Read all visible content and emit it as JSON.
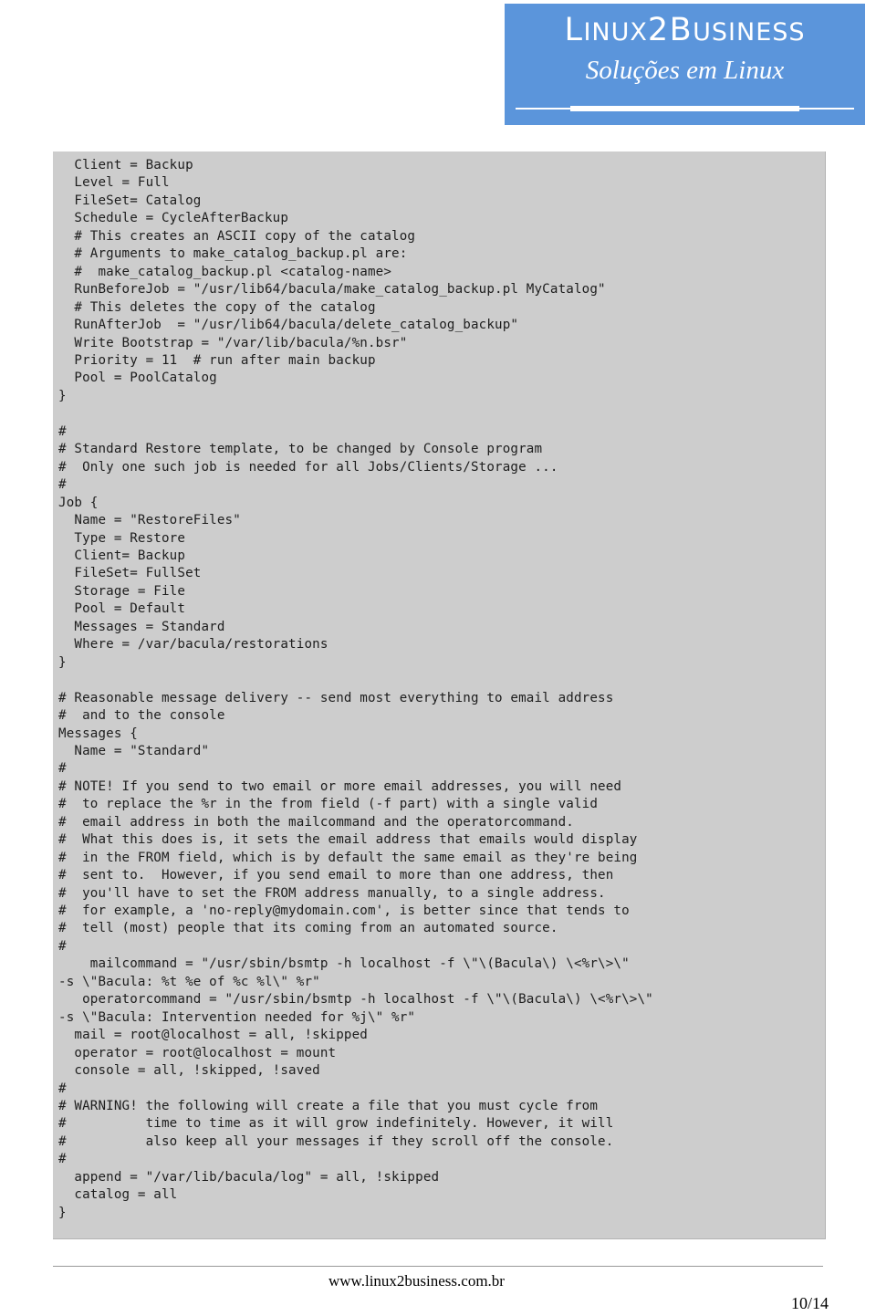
{
  "header": {
    "logo": {
      "wordmark_prefix": "L",
      "wordmark_small_1": "INUX",
      "wordmark_big": "2B",
      "wordmark_small_2": "USINESS",
      "wordmark_full": "LINUX2BUSINESS",
      "tagline": "Soluções em Linux",
      "background_color": "#5b95db",
      "text_color": "#ffffff"
    }
  },
  "code_block": {
    "background_color": "#cdcdcd",
    "text_color": "#1d1d1d",
    "language": "bacula-config",
    "content": "  Client = Backup\n  Level = Full\n  FileSet= Catalog\n  Schedule = CycleAfterBackup\n  # This creates an ASCII copy of the catalog\n  # Arguments to make_catalog_backup.pl are:\n  #  make_catalog_backup.pl <catalog-name>\n  RunBeforeJob = \"/usr/lib64/bacula/make_catalog_backup.pl MyCatalog\"\n  # This deletes the copy of the catalog\n  RunAfterJob  = \"/usr/lib64/bacula/delete_catalog_backup\"\n  Write Bootstrap = \"/var/lib/bacula/%n.bsr\"\n  Priority = 11  # run after main backup\n  Pool = PoolCatalog\n}\n\n#\n# Standard Restore template, to be changed by Console program\n#  Only one such job is needed for all Jobs/Clients/Storage ...\n#\nJob {\n  Name = \"RestoreFiles\"\n  Type = Restore\n  Client= Backup\n  FileSet= FullSet\n  Storage = File\n  Pool = Default\n  Messages = Standard\n  Where = /var/bacula/restorations\n}\n\n# Reasonable message delivery -- send most everything to email address\n#  and to the console\nMessages {\n  Name = \"Standard\"\n#\n# NOTE! If you send to two email or more email addresses, you will need\n#  to replace the %r in the from field (-f part) with a single valid\n#  email address in both the mailcommand and the operatorcommand.\n#  What this does is, it sets the email address that emails would display\n#  in the FROM field, which is by default the same email as they're being\n#  sent to.  However, if you send email to more than one address, then\n#  you'll have to set the FROM address manually, to a single address.\n#  for example, a 'no-reply@mydomain.com', is better since that tends to\n#  tell (most) people that its coming from an automated source.\n#\n    mailcommand = \"/usr/sbin/bsmtp -h localhost -f \\\"\\(Bacula\\) \\<%r\\>\\\"\n-s \\\"Bacula: %t %e of %c %l\\\" %r\"\n   operatorcommand = \"/usr/sbin/bsmtp -h localhost -f \\\"\\(Bacula\\) \\<%r\\>\\\"\n-s \\\"Bacula: Intervention needed for %j\\\" %r\"\n  mail = root@localhost = all, !skipped\n  operator = root@localhost = mount\n  console = all, !skipped, !saved\n#\n# WARNING! the following will create a file that you must cycle from\n#          time to time as it will grow indefinitely. However, it will\n#          also keep all your messages if they scroll off the console.\n#\n  append = \"/var/lib/bacula/log\" = all, !skipped\n  catalog = all\n}"
  },
  "footer": {
    "site_url": "www.linux2business.com.br",
    "page_number": "10/14"
  }
}
